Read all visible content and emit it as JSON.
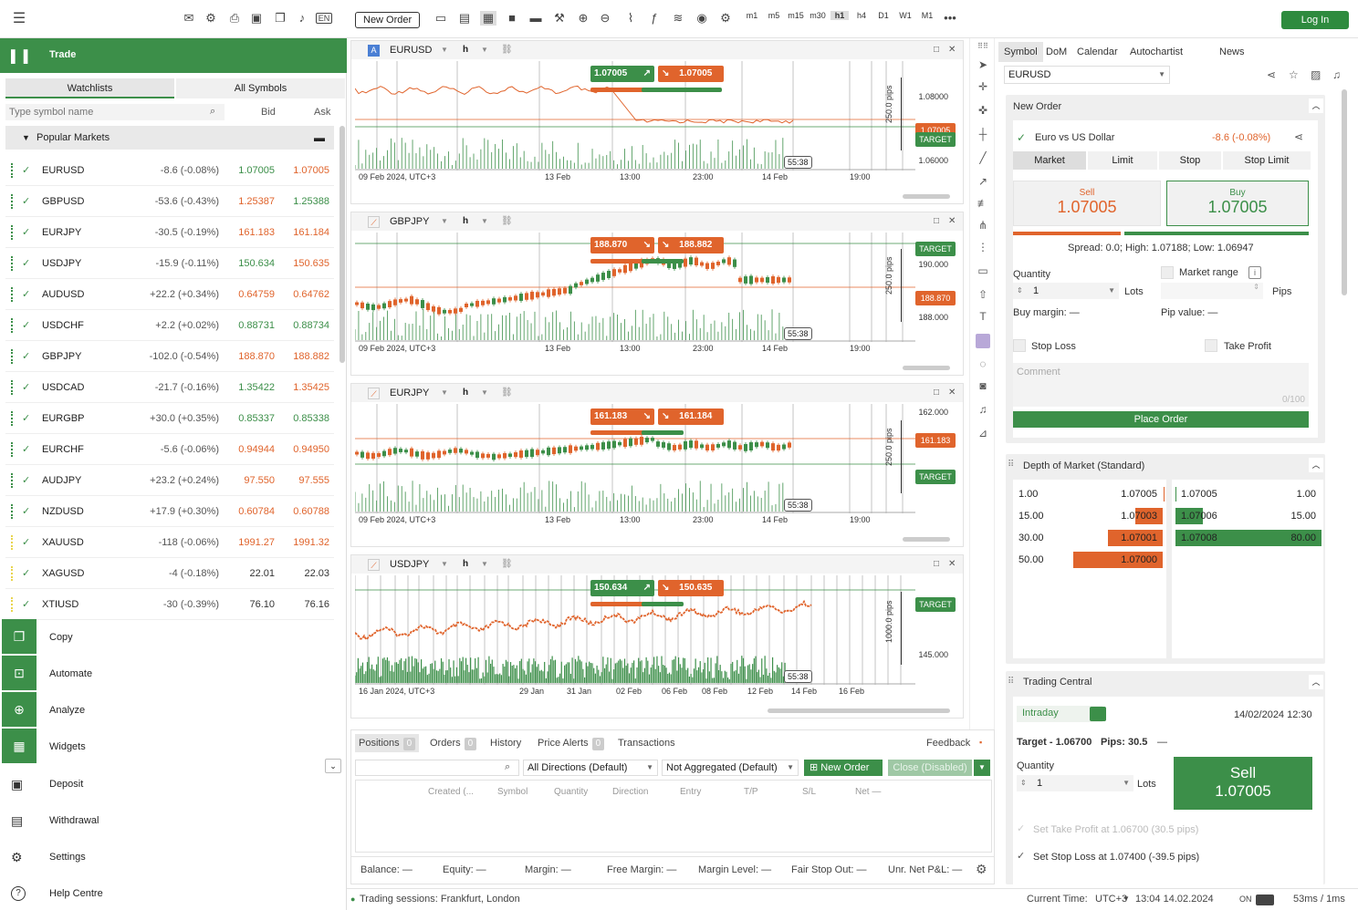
{
  "topbar": {
    "new_order": "New Order",
    "login": "Log In",
    "lang": "EN",
    "timeframes": [
      "m1",
      "m5",
      "m15",
      "m30",
      "h1",
      "h4",
      "D1",
      "W1",
      "M1"
    ],
    "more": "•••"
  },
  "left": {
    "trade": "Trade",
    "tab_watchlists": "Watchlists",
    "tab_all_symbols": "All Symbols",
    "search_placeholder": "Type symbol name",
    "col_bid": "Bid",
    "col_ask": "Ask",
    "group": "Popular Markets",
    "rows": [
      {
        "sym": "EURUSD",
        "chg": "-8.6 (-0.08%)",
        "bid": "1.07005",
        "ask": "1.07005",
        "bid_dir": "up",
        "ask_dir": "dn"
      },
      {
        "sym": "GBPUSD",
        "chg": "-53.6 (-0.43%)",
        "bid": "1.25387",
        "ask": "1.25388",
        "bid_dir": "dn",
        "ask_dir": "up"
      },
      {
        "sym": "EURJPY",
        "chg": "-30.5 (-0.19%)",
        "bid": "161.183",
        "ask": "161.184",
        "bid_dir": "dn",
        "ask_dir": "dn"
      },
      {
        "sym": "USDJPY",
        "chg": "-15.9 (-0.11%)",
        "bid": "150.634",
        "ask": "150.635",
        "bid_dir": "up",
        "ask_dir": "dn"
      },
      {
        "sym": "AUDUSD",
        "chg": "+22.2 (+0.34%)",
        "bid": "0.64759",
        "ask": "0.64762",
        "bid_dir": "dn",
        "ask_dir": "dn"
      },
      {
        "sym": "USDCHF",
        "chg": "+2.2 (+0.02%)",
        "bid": "0.88731",
        "ask": "0.88734",
        "bid_dir": "up",
        "ask_dir": "up"
      },
      {
        "sym": "GBPJPY",
        "chg": "-102.0 (-0.54%)",
        "bid": "188.870",
        "ask": "188.882",
        "bid_dir": "dn",
        "ask_dir": "dn"
      },
      {
        "sym": "USDCAD",
        "chg": "-21.7 (-0.16%)",
        "bid": "1.35422",
        "ask": "1.35425",
        "bid_dir": "up",
        "ask_dir": "dn"
      },
      {
        "sym": "EURGBP",
        "chg": "+30.0 (+0.35%)",
        "bid": "0.85337",
        "ask": "0.85338",
        "bid_dir": "up",
        "ask_dir": "up"
      },
      {
        "sym": "EURCHF",
        "chg": "-5.6 (-0.06%)",
        "bid": "0.94944",
        "ask": "0.94950",
        "bid_dir": "dn",
        "ask_dir": "dn"
      },
      {
        "sym": "AUDJPY",
        "chg": "+23.2 (+0.24%)",
        "bid": "97.550",
        "ask": "97.555",
        "bid_dir": "dn",
        "ask_dir": "dn"
      },
      {
        "sym": "NZDUSD",
        "chg": "+17.9 (+0.30%)",
        "bid": "0.60784",
        "ask": "0.60788",
        "bid_dir": "dn",
        "ask_dir": "dn"
      },
      {
        "sym": "XAUUSD",
        "chg": "-118 (-0.06%)",
        "bid": "1991.27",
        "ask": "1991.32",
        "bid_dir": "dn",
        "ask_dir": "dn"
      },
      {
        "sym": "XAGUSD",
        "chg": "-4 (-0.18%)",
        "bid": "22.01",
        "ask": "22.03",
        "bid_dir": "none",
        "ask_dir": "none"
      },
      {
        "sym": "XTIUSD",
        "chg": "-30 (-0.39%)",
        "bid": "76.10",
        "ask": "76.16",
        "bid_dir": "none",
        "ask_dir": "none"
      }
    ],
    "nav": [
      "Copy",
      "Automate",
      "Analyze",
      "Widgets"
    ],
    "nav2": [
      "Deposit",
      "Withdrawal",
      "Settings",
      "Help Centre"
    ]
  },
  "charts": [
    {
      "symbol": "EURUSD",
      "tf": "h",
      "sell": "1.07005",
      "buy": "1.07005",
      "p1": "1.08000",
      "p2": "1.06000",
      "cur": "1.07005",
      "pips": "250.0 pips",
      "d0": "09 Feb 2024, UTC+3",
      "t": [
        "13 Feb",
        "13:00",
        "23:00",
        "14 Feb",
        "19:00"
      ],
      "clock": "55:38",
      "target": "TARGET"
    },
    {
      "symbol": "GBPJPY",
      "tf": "h",
      "sell": "188.870",
      "buy": "188.882",
      "p1": "190.000",
      "p2": "188.000",
      "cur": "188.870",
      "pips": "250.0 pips",
      "d0": "09 Feb 2024, UTC+3",
      "t": [
        "13 Feb",
        "13:00",
        "23:00",
        "14 Feb",
        "19:00"
      ],
      "clock": "55:38",
      "target": "TARGET"
    },
    {
      "symbol": "EURJPY",
      "tf": "h",
      "sell": "161.183",
      "buy": "161.184",
      "p1": "162.000",
      "p2": "",
      "cur": "161.183",
      "pips": "250.0 pips",
      "d0": "09 Feb 2024, UTC+3",
      "t": [
        "13 Feb",
        "13:00",
        "23:00",
        "14 Feb",
        "19:00"
      ],
      "clock": "55:38",
      "target": "TARGET"
    },
    {
      "symbol": "USDJPY",
      "tf": "h",
      "sell": "150.634",
      "buy": "150.635",
      "p1": "",
      "p2": "145.000",
      "cur": "",
      "pips": "1000.0 pips",
      "d0": "16 Jan 2024, UTC+3",
      "t": [
        "29 Jan",
        "31 Jan",
        "02 Feb",
        "06 Feb",
        "08 Feb",
        "12 Feb",
        "14 Feb",
        "16 Feb"
      ],
      "clock": "55:38",
      "target": "TARGET"
    }
  ],
  "bottom": {
    "tabs": [
      {
        "label": "Positions",
        "n": "0"
      },
      {
        "label": "Orders",
        "n": "0"
      },
      {
        "label": "History"
      },
      {
        "label": "Price Alerts",
        "n": "0"
      },
      {
        "label": "Transactions"
      }
    ],
    "feedback": "Feedback",
    "dir": "All Directions (Default)",
    "agg": "Not Aggregated (Default)",
    "new_order": "New Order",
    "close": "Close (Disabled)",
    "cols": [
      "Created (...",
      "Symbol",
      "Quantity",
      "Direction",
      "Entry",
      "T/P",
      "S/L",
      "Net —"
    ],
    "stats": [
      "Balance: —",
      "Equity: —",
      "Margin: —",
      "Free Margin: —",
      "Margin Level: —",
      "Fair Stop Out: —",
      "Unr. Net P&L: —"
    ]
  },
  "right": {
    "tabs": [
      "Symbol",
      "DoM",
      "Calendar",
      "Autochartist",
      "News"
    ],
    "symbol": "EURUSD",
    "new_order": "New Order",
    "name": "Euro vs US Dollar",
    "chg": "-8.6 (-0.08%)",
    "types": [
      "Market",
      "Limit",
      "Stop",
      "Stop Limit"
    ],
    "sell": "Sell",
    "sell_price": "1.07005",
    "buy": "Buy",
    "buy_price": "1.07005",
    "spread": "Spread: 0.0; High: 1.07188; Low: 1.06947",
    "quantity": "Quantity",
    "qty": "1",
    "lots": "Lots",
    "market_range": "Market range",
    "pips": "Pips",
    "buy_margin": "Buy margin: —",
    "pip_value": "Pip value: —",
    "stop_loss": "Stop Loss",
    "take_profit": "Take Profit",
    "comment": "Comment",
    "count": "0/100",
    "place": "Place Order",
    "dom_title": "Depth of Market (Standard)",
    "dom_left": [
      [
        "1.00",
        "1.07005"
      ],
      [
        "15.00",
        "1.07003"
      ],
      [
        "30.00",
        "1.07001"
      ],
      [
        "50.00",
        "1.07000"
      ]
    ],
    "dom_right": [
      [
        "1.07005",
        "1.00"
      ],
      [
        "1.07006",
        "15.00"
      ],
      [
        "1.07008",
        "80.00"
      ]
    ],
    "tc_title": "Trading Central",
    "tc_intraday": "Intraday",
    "tc_date": "14/02/2024 12:30",
    "tc_target": "Target - 1.06700",
    "tc_pips": "Pips: 30.5",
    "tc_dash": "—",
    "tc_qty": "Quantity",
    "tc_sell": "Sell",
    "tc_sell_price": "1.07005",
    "tc_tp": "Set Take Profit at 1.06700 (30.5 pips)",
    "tc_sl": "Set Stop Loss at 1.07400 (-39.5 pips)"
  },
  "status": {
    "sessions": "Trading sessions: Frankfurt, London",
    "current_time": "Current Time:",
    "tz": "UTC+3",
    "time": "13:04 14.02.2024",
    "on": "ON",
    "latency": "53ms / 1ms"
  },
  "colors": {
    "green": "#3c8f49",
    "orange": "#e0642c"
  }
}
